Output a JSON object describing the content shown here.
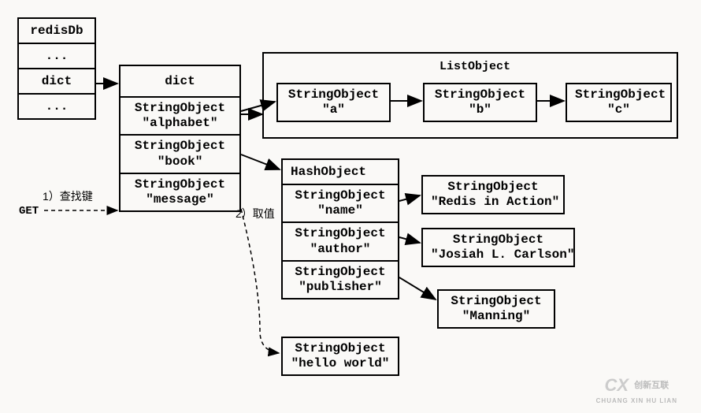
{
  "redisDb": {
    "header": "redisDb",
    "row1": "...",
    "row2": "dict",
    "row3": "..."
  },
  "dict": {
    "header": "dict",
    "key0_type": "StringObject",
    "key0_val": "\"alphabet\"",
    "key1_type": "StringObject",
    "key1_val": "\"book\"",
    "key2_type": "StringObject",
    "key2_val": "\"message\""
  },
  "list": {
    "label": "ListObject",
    "a_type": "StringObject",
    "a_val": "\"a\"",
    "b_type": "StringObject",
    "b_val": "\"b\"",
    "c_type": "StringObject",
    "c_val": "\"c\""
  },
  "hash": {
    "header": "HashObject",
    "k0_type": "StringObject",
    "k0_val": "\"name\"",
    "k1_type": "StringObject",
    "k1_val": "\"author\"",
    "k2_type": "StringObject",
    "k2_val": "\"publisher\"",
    "v0_type": "StringObject",
    "v0_val": "\"Redis in Action\"",
    "v1_type": "StringObject",
    "v1_val": "\"Josiah L. Carlson\"",
    "v2_type": "StringObject",
    "v2_val": "\"Manning\""
  },
  "message_value": {
    "type": "StringObject",
    "val": "\"hello world\""
  },
  "annotations": {
    "step1": "1）查找键",
    "step2": "2）取值",
    "get": "GET"
  },
  "watermark": {
    "logo": "CX",
    "text1": "创新互联",
    "text2": "CHUANG XIN HU LIAN"
  }
}
